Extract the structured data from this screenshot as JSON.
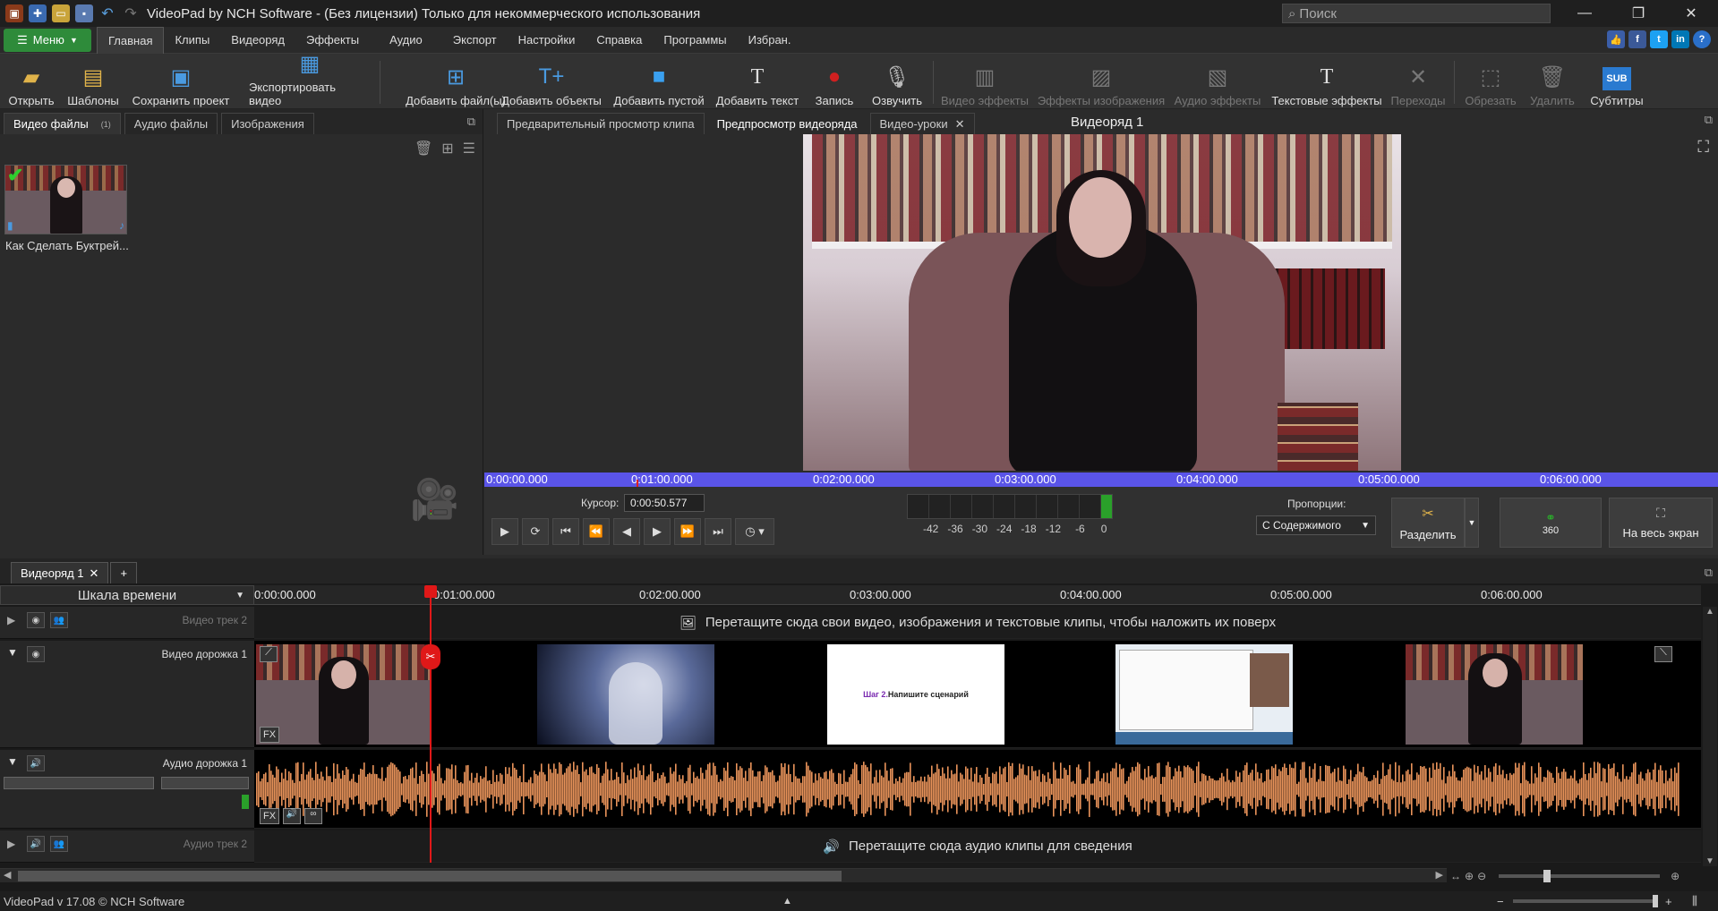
{
  "title": "VideoPad by NCH Software - (Без лицензии) Только для некоммерческого использования",
  "search_placeholder": "Поиск",
  "menu": {
    "menu_button": "Меню",
    "tabs": [
      "Главная",
      "Клипы",
      "Видеоряд",
      "Эффекты",
      "Аудио",
      "Экспорт",
      "Настройки",
      "Справка",
      "Программы",
      "Избран."
    ]
  },
  "ribbon": {
    "open": "Открыть",
    "templates": "Шаблоны",
    "save_project": "Сохранить проект",
    "export_video": "Экспортировать видео",
    "add_files": "Добавить файл(ы)",
    "add_objects": "Добавить объекты",
    "add_blank": "Добавить пустой",
    "add_text": "Добавить текст",
    "record": "Запись",
    "narrate": "Озвучить",
    "video_effects": "Видео эффекты",
    "image_effects": "Эффекты изображения",
    "audio_effects": "Аудио эффекты",
    "text_effects": "Текстовые эффекты",
    "transitions": "Переходы",
    "crop": "Обрезать",
    "delete": "Удалить",
    "subtitles": "Субтитры"
  },
  "bin": {
    "tabs": [
      "Видео файлы",
      "Аудио файлы",
      "Изображения"
    ],
    "tab_badge": "(1)",
    "clip_caption": "Как Сделать Буктрей..."
  },
  "preview": {
    "tabs": [
      "Предварительный просмотр клипа",
      "Предпросмотр видеоряда",
      "Видео-уроки"
    ],
    "title": "Видеоряд 1",
    "timebar_labels": [
      "0:00:00.000",
      "0:01:00.000",
      "0:02:00.000",
      "0:03:00.000",
      "0:04:00.000",
      "0:05:00.000",
      "0:06:00.000"
    ],
    "cursor_label": "Курсор:",
    "cursor_value": "0:00:50.577",
    "meter_labels": [
      "-42",
      "-36",
      "-30",
      "-24",
      "-18",
      "-12",
      "-6",
      "0"
    ],
    "aspect_label": "Пропорции:",
    "aspect_value": "С Содержимого",
    "split": "Разделить",
    "btn_360": "360",
    "fullscreen": "На весь экран"
  },
  "timeline": {
    "tab": "Видеоряд 1",
    "scale_label": "Шкала времени",
    "ruler_labels": [
      "0:00:00.000",
      "0:01:00.000",
      "0:02:00.000",
      "0:03:00.000",
      "0:04:00.000",
      "0:05:00.000",
      "0:06:00.000"
    ],
    "video_track_2": "Видео трек 2",
    "video_track_2_hint": "Перетащите сюда свои видео, изображения и текстовые клипы, чтобы наложить их поверх",
    "video_track_1": "Видео дорожка 1",
    "audio_track_1": "Аудио дорожка 1",
    "audio_track_2": "Аудио трек 2",
    "audio_track_2_hint": "Перетащите сюда аудио клипы для сведения",
    "clip3_text_step": "Шаг 2.",
    "clip3_text_rest": " Напишите сценарий",
    "fx_label": "FX"
  },
  "status": "VideoPad v 17.08 © NCH Software",
  "colors": {
    "accent_green": "#2e8b3a",
    "timebar": "#5a54e8",
    "waveform": "#e8935a",
    "playhead": "#e01818"
  }
}
